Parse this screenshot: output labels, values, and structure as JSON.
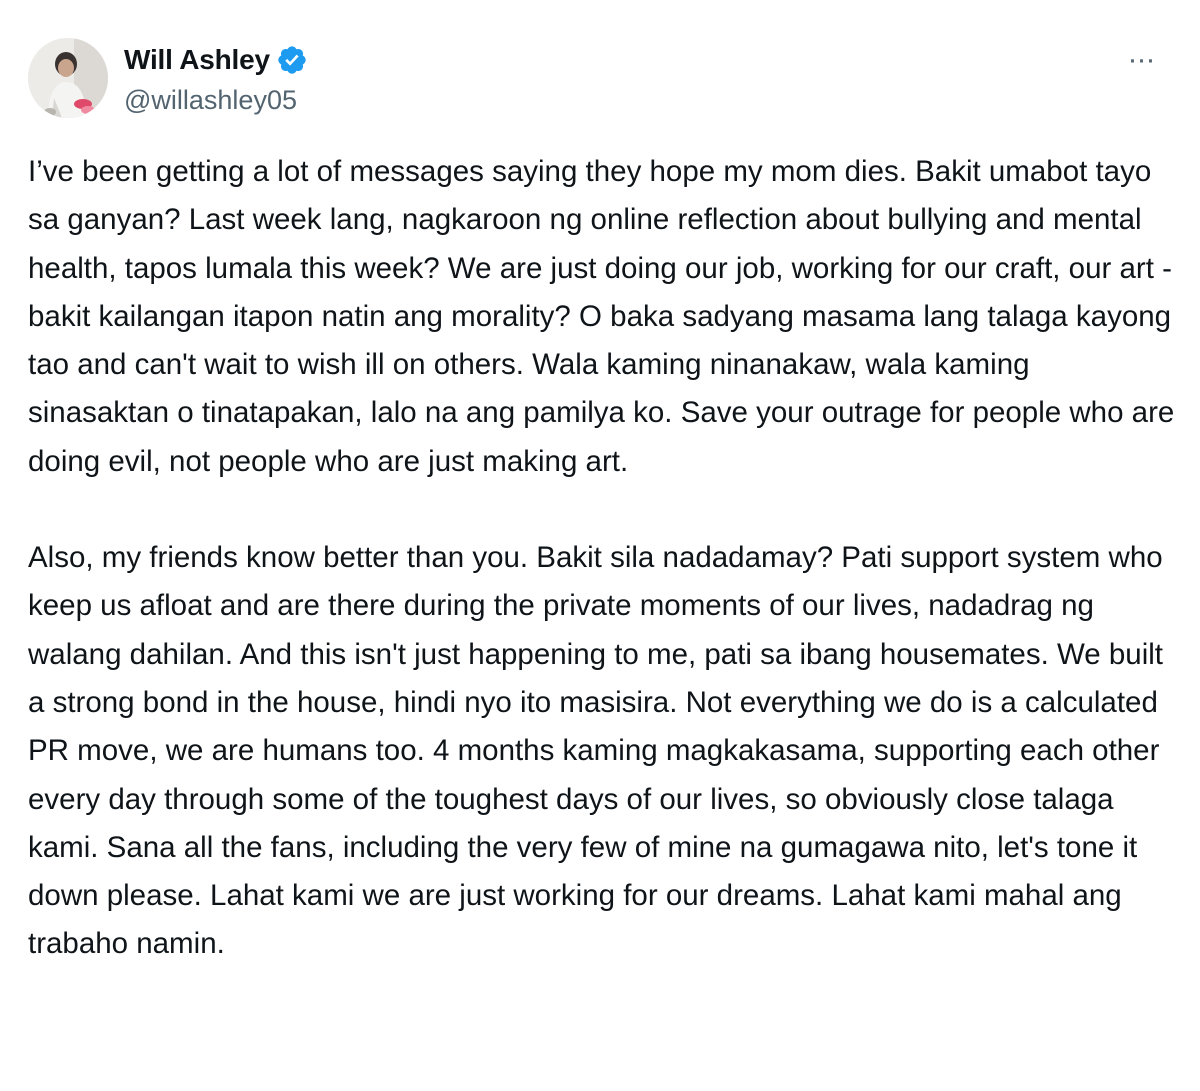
{
  "author": {
    "name": "Will Ashley",
    "handle": "@willashley05",
    "verified_color": "#1d9bf0",
    "avatar_icon": "profile-photo"
  },
  "menu": {
    "more_label": "···"
  },
  "tweet": {
    "paragraphs": [
      "I’ve been getting a lot of messages saying they hope my mom dies. Bakit umabot tayo sa ganyan? Last week lang, nagkaroon ng online reflection about bullying and mental health, tapos lumala this week? We are just doing our job, working for our craft, our art - bakit kailangan itapon natin ang morality? O baka sadyang masama lang talaga kayong tao and can't wait to wish ill on others. Wala kaming ninanakaw, wala kaming sinasaktan o tinatapakan, lalo na ang pamilya ko. Save your outrage for people who are doing evil, not people who are just making art.",
      "Also, my friends know better than you. Bakit sila nadadamay? Pati support system who keep us afloat and are there during the private moments of our lives, nadadrag ng walang dahilan. And this isn't just happening to me, pati sa ibang housemates. We built a strong bond in the house, hindi nyo ito masisira. Not everything we do is a calculated PR move, we are humans too. 4 months kaming magkakasama, supporting each other every day through some of the toughest days of our lives, so obviously close talaga kami. Sana all the fans, including the very few of mine na gumagawa nito, let's tone it down please. Lahat kami we are just working for our dreams. Lahat kami mahal ang trabaho namin."
    ]
  }
}
